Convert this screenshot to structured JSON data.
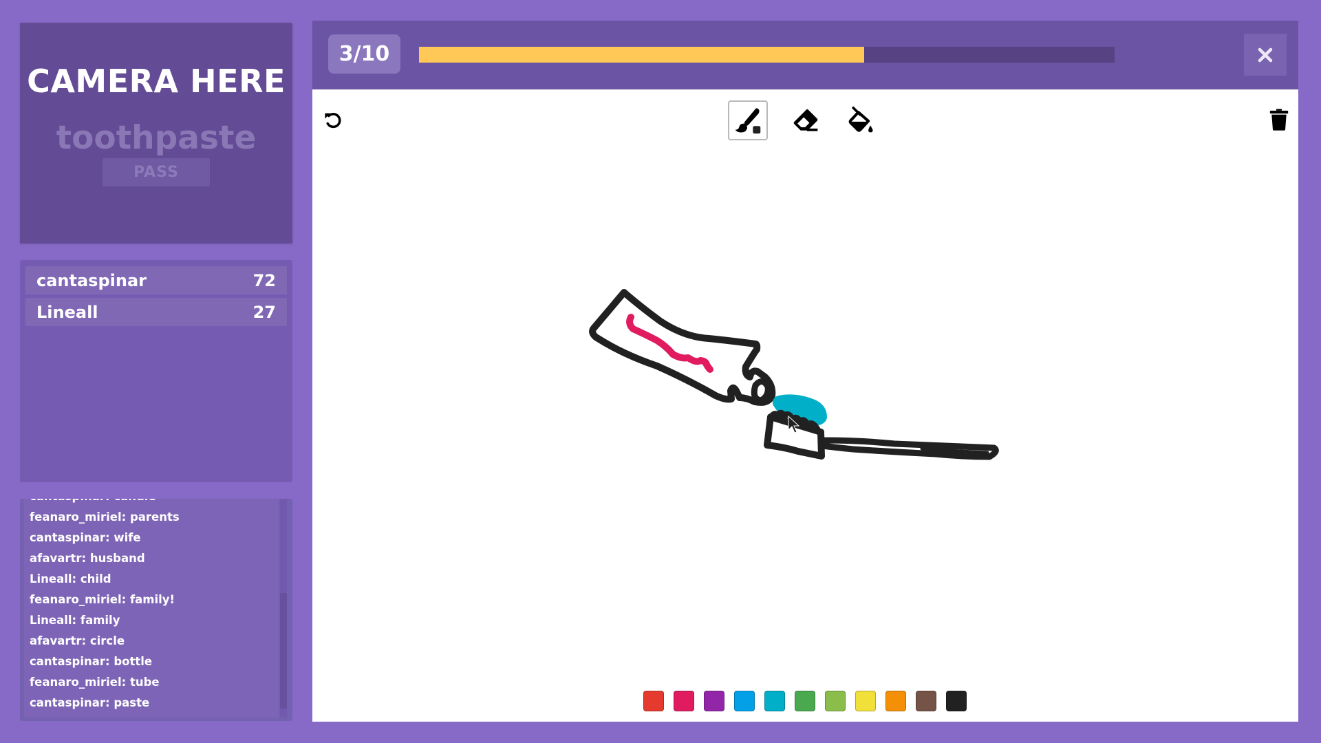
{
  "camera_panel": {
    "title": "CAMERA HERE",
    "secret_word": "toothpaste",
    "pass_label": "PASS"
  },
  "scoreboard": {
    "players": [
      {
        "name": "cantaspinar",
        "score": "72"
      },
      {
        "name": "Lineall",
        "score": "27"
      }
    ]
  },
  "chat": {
    "messages": [
      "cantaspinar: candle",
      "feanaro_miriel: parents",
      "cantaspinar: wife",
      "afavartr: husband",
      "Lineall: child",
      "feanaro_miriel: family!",
      "Lineall: family",
      "afavartr: circle",
      "cantaspinar: bottle",
      "feanaro_miriel: tube",
      "cantaspinar: paste"
    ]
  },
  "header": {
    "round": "3/10",
    "timer_remaining_fraction": 0.64,
    "close_icon": "close-icon"
  },
  "toolbar": {
    "undo_icon": "undo-icon",
    "tools": [
      {
        "id": "brush",
        "icon": "paintbrush-icon",
        "selected": true
      },
      {
        "id": "eraser",
        "icon": "eraser-icon",
        "selected": false
      },
      {
        "id": "fill",
        "icon": "paint-bucket-icon",
        "selected": false
      }
    ],
    "clear_icon": "trash-icon",
    "current_color": "#212121"
  },
  "palette": {
    "colors": [
      {
        "name": "red",
        "hex": "#e53b2f"
      },
      {
        "name": "pink",
        "hex": "#e01b5f"
      },
      {
        "name": "purple",
        "hex": "#9326a8"
      },
      {
        "name": "blue",
        "hex": "#03a0e8"
      },
      {
        "name": "cyan",
        "hex": "#01afc9"
      },
      {
        "name": "green",
        "hex": "#4aa84e"
      },
      {
        "name": "light-green",
        "hex": "#8bbd4a"
      },
      {
        "name": "yellow",
        "hex": "#f1df3a"
      },
      {
        "name": "orange",
        "hex": "#f48f08"
      },
      {
        "name": "brown",
        "hex": "#765347"
      },
      {
        "name": "black",
        "hex": "#212121"
      }
    ]
  },
  "drawing": {
    "description": "toothpaste tube squeezing paste onto a toothbrush",
    "stroke_colors": {
      "outline": "#212121",
      "tube_stripe": "#e01b5f",
      "paste": "#01afc9"
    }
  }
}
